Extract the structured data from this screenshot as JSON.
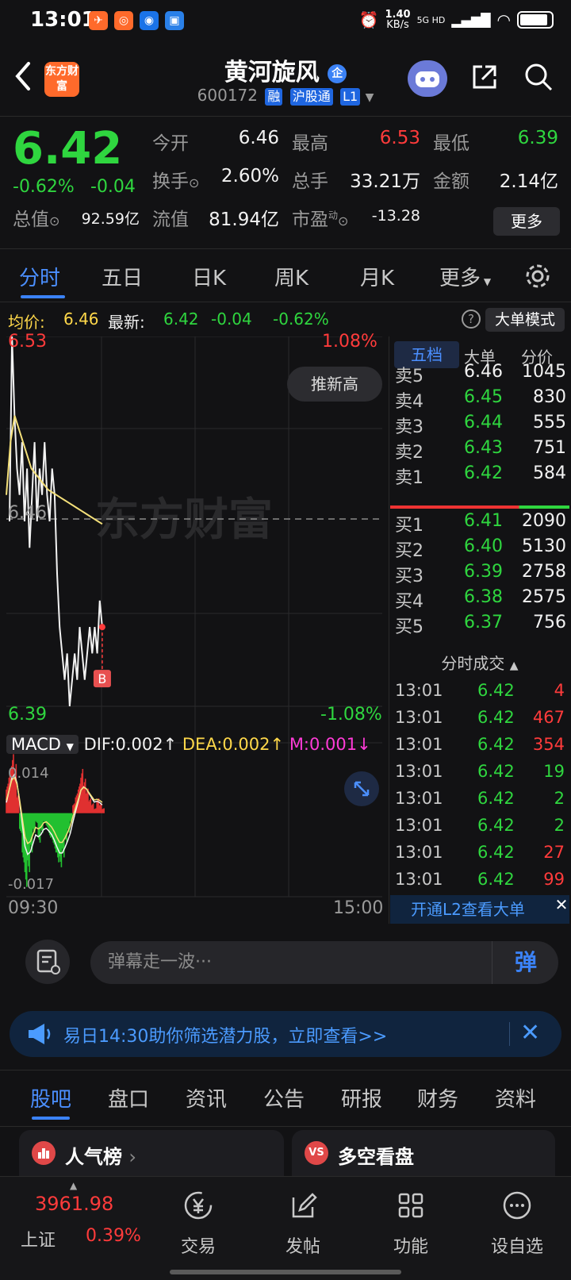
{
  "status": {
    "time": "13:01",
    "net_speed": "1.40",
    "net_unit": "KB/s",
    "network": "5G HD"
  },
  "header": {
    "brand": "东方财富",
    "name": "黄河旋风",
    "code": "600172",
    "tags": [
      "融",
      "沪股通",
      "L1"
    ]
  },
  "quote": {
    "price": "6.42",
    "chg_pct": "-0.62%",
    "chg_amt": "-0.04",
    "fields": [
      {
        "label": "今开",
        "value": "6.46"
      },
      {
        "label": "最高",
        "value": "6.53"
      },
      {
        "label": "最低",
        "value": "6.39"
      },
      {
        "label": "换手",
        "value": "2.60%"
      },
      {
        "label": "总手",
        "value": "33.21万"
      },
      {
        "label": "金额",
        "value": "2.14亿"
      },
      {
        "label": "总值",
        "value": "92.59亿"
      },
      {
        "label": "流值",
        "value": "81.94亿"
      },
      {
        "label": "市盈",
        "value": "-13.28"
      }
    ],
    "pe_sup": "动",
    "more": "更多"
  },
  "tabs": [
    "分时",
    "五日",
    "日K",
    "周K",
    "月K",
    "更多"
  ],
  "avg_row": {
    "avg_label": "均价:",
    "avg_value": "6.46",
    "last_label": "最新:",
    "last_value": "6.42",
    "chg": "-0.04",
    "pct": "-0.62%",
    "big_mode": "大单模式"
  },
  "chart_data": {
    "type": "line",
    "series": [],
    "price_points": [
      6.46,
      6.53,
      6.5,
      6.48,
      6.47,
      6.49,
      6.46,
      6.48,
      6.45,
      6.47,
      6.49,
      6.46,
      6.48,
      6.47,
      6.49,
      6.47,
      6.46,
      6.48,
      6.47,
      6.44,
      6.42,
      6.41,
      6.4,
      6.41,
      6.39,
      6.4,
      6.41,
      6.4,
      6.42,
      6.41,
      6.4,
      6.41,
      6.42,
      6.41,
      6.42,
      6.41,
      6.43,
      6.42
    ],
    "avg_points": [
      6.47,
      6.49,
      6.5,
      6.495,
      6.49,
      6.485,
      6.48,
      6.478,
      6.476,
      6.474,
      6.472,
      6.471,
      6.47,
      6.469,
      6.468,
      6.467,
      6.466,
      6.465,
      6.464,
      6.463,
      6.462,
      6.461,
      6.46,
      6.459
    ],
    "ylim": [
      6.39,
      6.53
    ],
    "y_labels": {
      "top": "6.53",
      "mid": "6.46",
      "bottom": "6.39",
      "top_pct": "1.08%",
      "bottom_pct": "-1.08%"
    },
    "x_labels": [
      "09:30",
      "15:00"
    ],
    "marker": "B",
    "push_high": "推新高",
    "watermark": "东方财富"
  },
  "macd": {
    "label": "MACD",
    "dif": "DIF:0.002",
    "dea": "DEA:0.002",
    "m": "M:0.001",
    "max": "0.014",
    "min": "-0.017",
    "bars": [
      0.006,
      0.009,
      0.012,
      0.01,
      0.004,
      -0.004,
      -0.01,
      -0.015,
      -0.012,
      -0.008,
      -0.004,
      -0.002,
      -0.006,
      -0.004,
      -0.002,
      -0.003,
      -0.005,
      -0.006,
      -0.008,
      -0.01,
      -0.011,
      -0.009,
      -0.006,
      -0.004,
      -0.002,
      0.002,
      0.004,
      0.006,
      0.009,
      0.007,
      0.005,
      0.003,
      0.002,
      0.001,
      0.003,
      0.002,
      0.001
    ]
  },
  "book": {
    "tabs": [
      "五档",
      "大单",
      "分价"
    ],
    "asks": [
      {
        "label": "卖5",
        "price": "6.46",
        "vol": "1045"
      },
      {
        "label": "卖4",
        "price": "6.45",
        "vol": "830"
      },
      {
        "label": "卖3",
        "price": "6.44",
        "vol": "555"
      },
      {
        "label": "卖2",
        "price": "6.43",
        "vol": "751"
      },
      {
        "label": "卖1",
        "price": "6.42",
        "vol": "584"
      }
    ],
    "bids": [
      {
        "label": "买1",
        "price": "6.41",
        "vol": "2090"
      },
      {
        "label": "买2",
        "price": "6.40",
        "vol": "5130"
      },
      {
        "label": "买3",
        "price": "6.39",
        "vol": "2758"
      },
      {
        "label": "买4",
        "price": "6.38",
        "vol": "2575"
      },
      {
        "label": "买5",
        "price": "6.37",
        "vol": "756"
      }
    ],
    "trades_title": "分时成交",
    "trades": [
      {
        "time": "13:01",
        "price": "6.42",
        "vol": "4",
        "side": "red"
      },
      {
        "time": "13:01",
        "price": "6.42",
        "vol": "467",
        "side": "red"
      },
      {
        "time": "13:01",
        "price": "6.42",
        "vol": "354",
        "side": "red"
      },
      {
        "time": "13:01",
        "price": "6.42",
        "vol": "19",
        "side": "green"
      },
      {
        "time": "13:01",
        "price": "6.42",
        "vol": "2",
        "side": "green"
      },
      {
        "time": "13:01",
        "price": "6.42",
        "vol": "2",
        "side": "green"
      },
      {
        "time": "13:01",
        "price": "6.42",
        "vol": "27",
        "side": "red"
      },
      {
        "time": "13:01",
        "price": "6.42",
        "vol": "99",
        "side": "red"
      }
    ],
    "l2_link": "开通L2查看大单"
  },
  "danmaku": {
    "placeholder": "弹幕走一波···",
    "button": "弹"
  },
  "banner": {
    "text": "易日14:30助你筛选潜力股，立即查看>>"
  },
  "sub_tabs": [
    "股吧",
    "盘口",
    "资讯",
    "公告",
    "研报",
    "财务",
    "资料"
  ],
  "cards": [
    "人气榜",
    "多空看盘"
  ],
  "bottom_nav": {
    "index_price": "3961.98",
    "index_name": "上证",
    "index_pct": "0.39%",
    "items": [
      "交易",
      "发帖",
      "功能",
      "设自选"
    ]
  },
  "colors": {
    "up": "#ff3b3b",
    "down": "#2fd63f",
    "accent": "#3b82f6",
    "avg_line": "#f4e07a"
  }
}
